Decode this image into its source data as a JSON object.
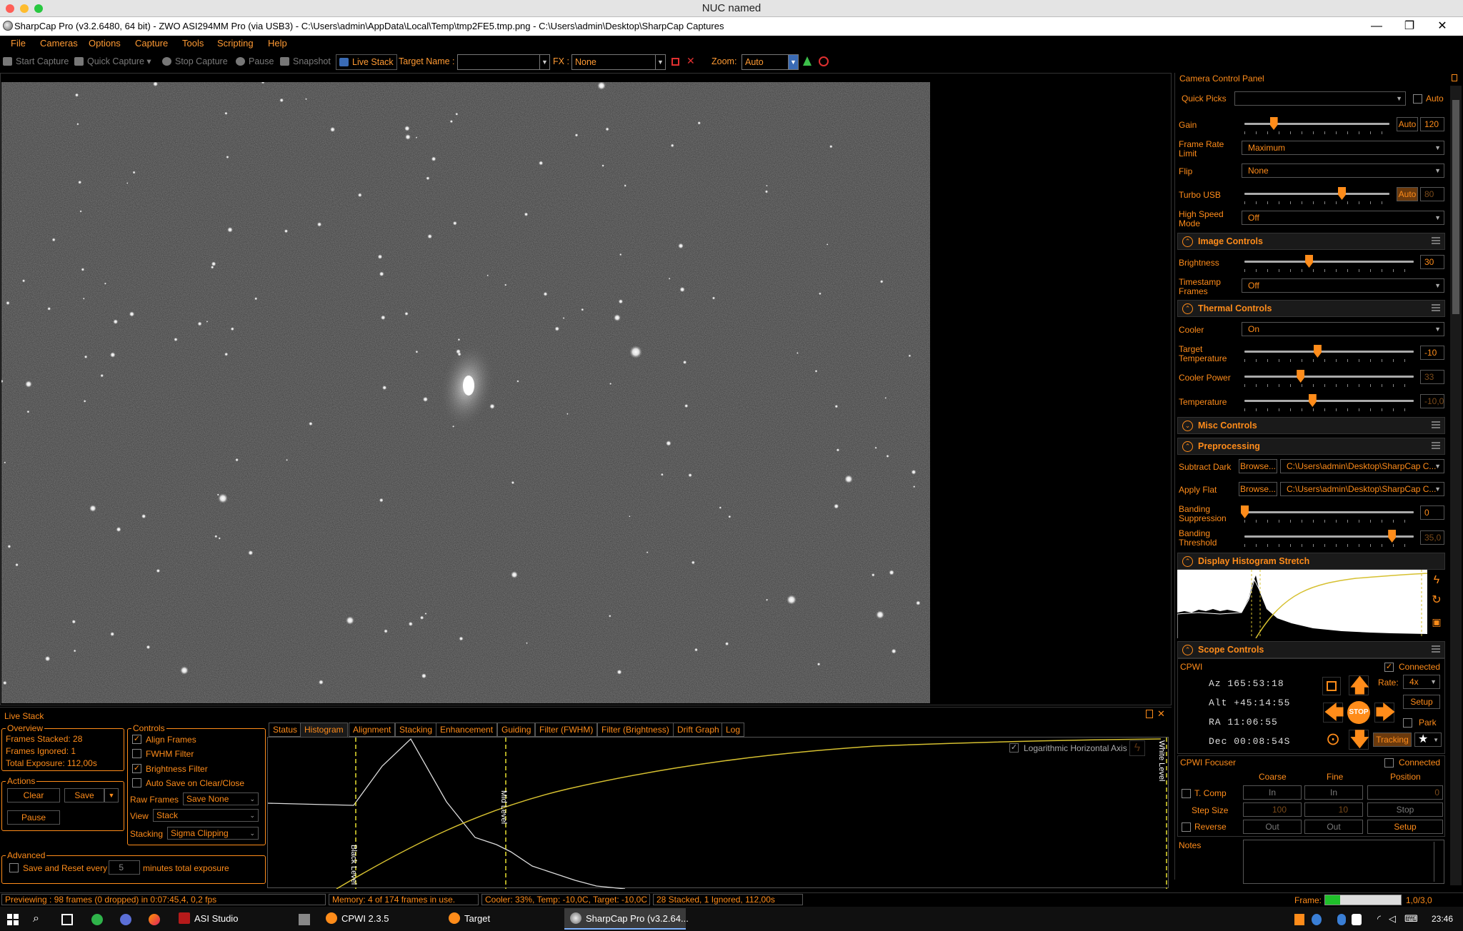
{
  "remote_bar": {
    "title": "NUC named"
  },
  "window": {
    "title": "SharpCap Pro (v3.2.6480, 64 bit) - ZWO ASI294MM Pro (via USB3) - C:\\Users\\admin\\AppData\\Local\\Temp\\tmp2FE5.tmp.png - C:\\Users\\admin\\Desktop\\SharpCap Captures",
    "minimize": "—",
    "restore": "❐",
    "close": "✕"
  },
  "menu": [
    "File",
    "Cameras",
    "Options",
    "Capture",
    "Tools",
    "Scripting",
    "Help"
  ],
  "toolbar": {
    "start_capture": "Start Capture",
    "quick_capture": "Quick Capture",
    "stop_capture": "Stop Capture",
    "pause": "Pause",
    "snapshot": "Snapshot",
    "live_stack": "Live Stack",
    "target_name_label": "Target Name :",
    "target_name_value": "",
    "fx_label": "FX :",
    "fx_value": "None",
    "zoom_label": "Zoom:",
    "zoom_value": "Auto"
  },
  "camera_panel": {
    "title": "Camera Control Panel",
    "quick_picks_label": "Quick Picks",
    "quick_picks_value": "",
    "auto_label": "Auto",
    "gain_label": "Gain",
    "gain_auto": "Auto",
    "gain_value": "120",
    "gain_level": 0.2,
    "frame_rate_label": "Frame Rate Limit",
    "frame_rate_value": "Maximum",
    "flip_label": "Flip",
    "flip_value": "None",
    "turbo_label": "Turbo USB",
    "turbo_auto": "Auto",
    "turbo_value": "80",
    "turbo_level": 0.67,
    "high_speed_label": "High Speed Mode",
    "high_speed_value": "Off",
    "image_controls": "Image Controls",
    "brightness_label": "Brightness",
    "brightness_value": "30",
    "brightness_level": 0.38,
    "timestamp_label": "Timestamp Frames",
    "timestamp_value": "Off",
    "thermal_controls": "Thermal Controls",
    "cooler_label": "Cooler",
    "cooler_value": "On",
    "target_temp_label": "Target Temperature",
    "target_temp_value": "-10",
    "target_temp_level": 0.43,
    "cooler_power_label": "Cooler Power",
    "cooler_power_value": "33",
    "cooler_power_level": 0.33,
    "temperature_label": "Temperature",
    "temperature_value": "-10,0",
    "temperature_level": 0.4,
    "misc_controls": "Misc Controls",
    "preprocessing": "Preprocessing",
    "subtract_dark_label": "Subtract Dark",
    "browse": "Browse...",
    "subtract_dark_value": "C:\\Users\\admin\\Desktop\\SharpCap C...",
    "apply_flat_label": "Apply Flat",
    "apply_flat_value": "C:\\Users\\admin\\Desktop\\SharpCap C...",
    "banding_supp_label": "Banding Suppression",
    "banding_supp_value": "0",
    "banding_supp_level": 0.0,
    "banding_thr_label": "Banding Threshold",
    "banding_thr_value": "35,0",
    "banding_thr_level": 0.87,
    "display_histo": "Display Histogram Stretch",
    "scope_controls": "Scope Controls",
    "cpwi_label": "CPWI",
    "connected_label": "Connected",
    "az": "Az  165:53:18",
    "alt": "Alt +45:14:55",
    "ra": "RA  11:06:55",
    "dec": "Dec 00:08:54S",
    "stop": "STOP",
    "rate_label": "Rate:",
    "rate_value": "4x",
    "setup": "Setup",
    "park": "Park",
    "tracking": "Tracking",
    "focuser_label": "CPWI Focuser",
    "focuser_connected": "Connected",
    "coarse": "Coarse",
    "fine": "Fine",
    "position": "Position",
    "tcomp": "T. Comp",
    "in": "In",
    "position_value": "0",
    "step_size": "Step Size",
    "coarse_step": "100",
    "fine_step": "10",
    "stop_btn": "Stop",
    "reverse": "Reverse",
    "out": "Out",
    "setup_btn": "Setup",
    "notes": "Notes"
  },
  "live_stack": {
    "title": "Live Stack",
    "overview": "Overview",
    "frames_stacked": "Frames Stacked:  28",
    "frames_ignored": "Frames Ignored:   1",
    "total_exposure": "Total Exposure:   112,00s",
    "actions": "Actions",
    "clear": "Clear",
    "save": "Save",
    "pause": "Pause",
    "controls": "Controls",
    "align_frames": "Align Frames",
    "fwhm_filter": "FWHM Filter",
    "brightness_filter": "Brightness Filter",
    "auto_save": "Auto Save on Clear/Close",
    "raw_frames_label": "Raw Frames",
    "raw_frames_value": "Save None",
    "view_label": "View",
    "view_value": "Stack",
    "stacking_label": "Stacking",
    "stacking_value": "Sigma Clipping",
    "advanced": "Advanced",
    "save_reset": "Save and Reset every",
    "save_reset_value": "5",
    "minutes_total": "minutes total exposure",
    "tabs": [
      "Status",
      "Histogram",
      "Alignment",
      "Stacking",
      "Enhancement",
      "Guiding",
      "Filter (FWHM)",
      "Filter (Brightness)",
      "Drift Graph",
      "Log"
    ],
    "log_axis": "Logarithmic Horizontal Axis",
    "black_level": "Black Level",
    "mid_level": "Mid Level",
    "white_level": "White Level"
  },
  "status": {
    "preview": "Previewing : 98 frames (0 dropped) in 0:07:45,4, 0,2 fps",
    "memory": "Memory: 4 of 174 frames in use.",
    "cooler": "Cooler: 33%, Temp: -10,0C, Target: -10,0C",
    "stacked": "28 Stacked, 1 Ignored, 112,00s",
    "frame_label": "Frame:",
    "frame_value": "1,0/3,0",
    "frame_level": 0.2
  },
  "taskbar": {
    "asi_studio": "ASI Studio",
    "cpwi": "CPWI 2.3.5",
    "target": "Target",
    "sharpcap": "SharpCap Pro (v3.2.64...",
    "clock": "23:46"
  }
}
